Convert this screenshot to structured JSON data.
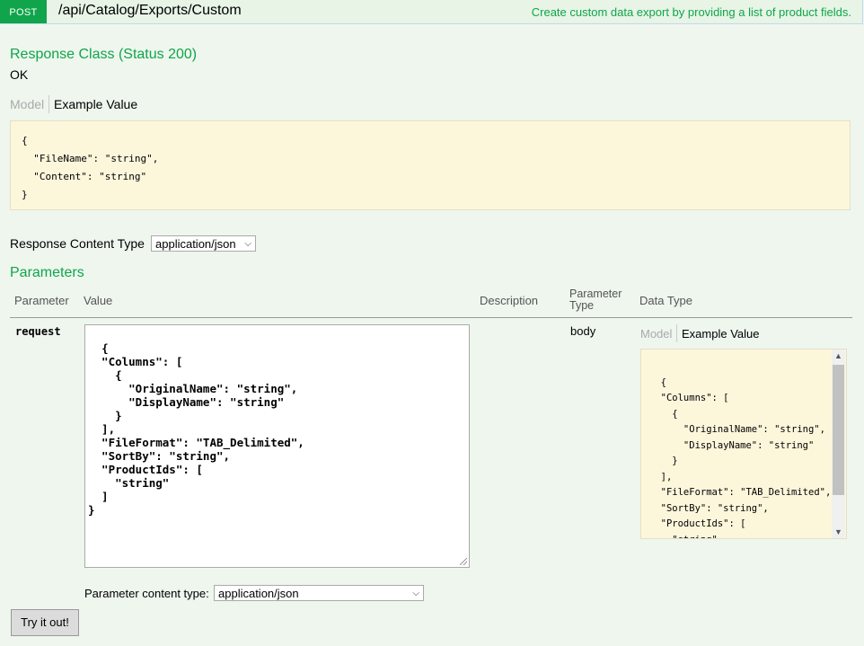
{
  "endpoint": {
    "method": "POST",
    "path": "/api/Catalog/Exports/Custom",
    "summary": "Create custom data export by providing a list of product fields."
  },
  "response": {
    "heading": "Response Class (Status 200)",
    "status_text": "OK",
    "tabs": {
      "model": "Model",
      "example": "Example Value"
    },
    "example_json": "{\n  \"FileName\": \"string\",\n  \"Content\": \"string\"\n}",
    "content_type_label": "Response Content Type",
    "content_type_value": "application/json"
  },
  "parameters": {
    "heading": "Parameters",
    "columns": {
      "parameter": "Parameter",
      "value": "Value",
      "description": "Description",
      "param_type": "Parameter\nType",
      "data_type": "Data Type"
    },
    "row": {
      "name": "request",
      "value_json": "{\n  \"Columns\": [\n    {\n      \"OriginalName\": \"string\",\n      \"DisplayName\": \"string\"\n    }\n  ],\n  \"FileFormat\": \"TAB_Delimited\",\n  \"SortBy\": \"string\",\n  \"ProductIds\": [\n    \"string\"\n  ]\n}",
      "param_type": "body",
      "tabs": {
        "model": "Model",
        "example": "Example Value"
      },
      "example_json": "{\n  \"Columns\": [\n    {\n      \"OriginalName\": \"string\",\n      \"DisplayName\": \"string\"\n    }\n  ],\n  \"FileFormat\": \"TAB_Delimited\",\n  \"SortBy\": \"string\",\n  \"ProductIds\": [\n    \"string\"\n  ]\n}"
    },
    "content_type_label": "Parameter content type:",
    "content_type_value": "application/json"
  },
  "try_button": "Try it out!",
  "colors": {
    "accent": "#10a54a",
    "code_bg": "#fcf6db",
    "page_bg": "#eef6ee"
  }
}
